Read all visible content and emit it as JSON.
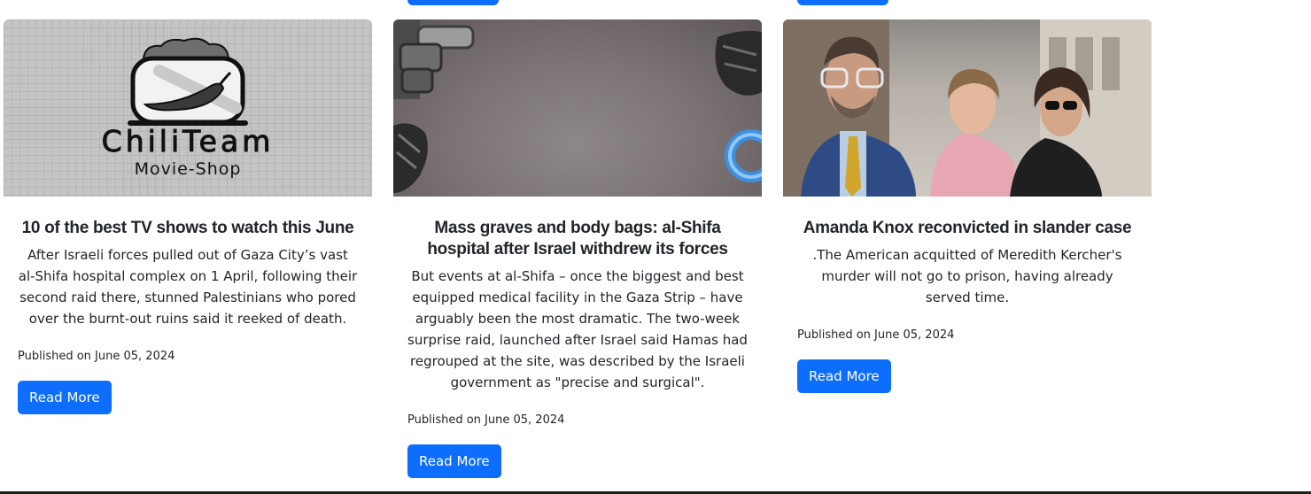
{
  "cards": [
    {
      "title": "10 of the best TV shows to watch this June",
      "text": "After Israeli forces pulled out of Gaza City’s vast al-Shifa hospital complex on 1 April, following their second raid there, stunned Palestinians who pored over the burnt-out ruins said it reeked of death.",
      "published": "Published on June 05, 2024",
      "button": "Read More",
      "image": {
        "logo_title": "ChiliTeam",
        "logo_subtitle": "Movie-Shop",
        "icon": "chili-jar-icon"
      }
    },
    {
      "title": "Mass graves and body bags: al-Shifa hospital after Israel withdrew its forces",
      "text": "But events at al-Shifa – once the biggest and best equipped medical facility in the Gaza Strip – have arguably been the most dramatic. The two-week surprise raid, launched after Israel said Hamas had regrouped at the site, was described by the Israeli government as \"precise and surgical\".",
      "published": "Published on June 05, 2024",
      "button": "Read More",
      "image": {
        "icon": "gym-equipment-photo"
      }
    },
    {
      "title": "Amanda Knox reconvicted in slander case",
      "text": ".The American acquitted of Meredith Kercher's murder will not go to prison, having already served time.",
      "published": "Published on June 05, 2024",
      "button": "Read More",
      "image": {
        "icon": "people-walking-photo"
      }
    }
  ],
  "colors": {
    "primary": "#0d6efd",
    "text": "#212529",
    "background": "#ffffff"
  }
}
